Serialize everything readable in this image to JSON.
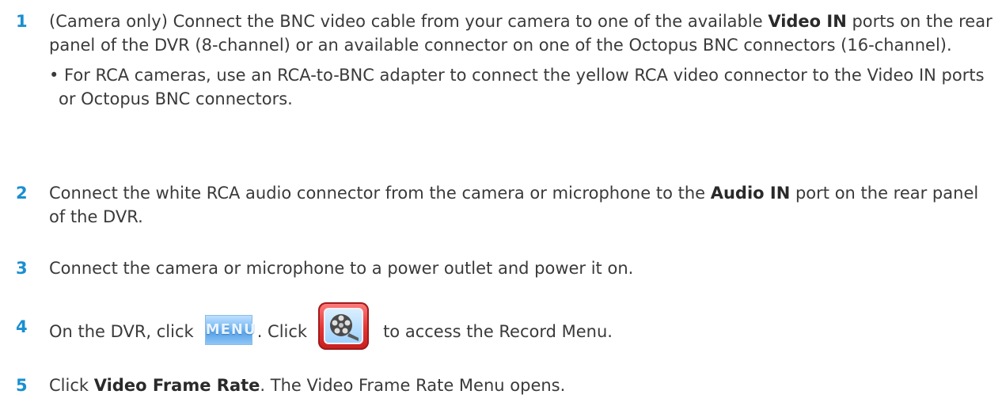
{
  "steps": [
    {
      "num": "1",
      "text_a": "(Camera only) Connect the BNC video cable from your camera to one of the available ",
      "bold_a": "Video IN",
      "text_b": " ports on the rear panel of the DVR (8-channel) or an available connector on one of the Octopus BNC connectors (16-channel).",
      "bullet": "• For RCA cameras, use an RCA-to-BNC adapter to connect the yellow RCA video connector to the Video IN ports or Octopus BNC connectors."
    },
    {
      "num": "2",
      "text_a": "Connect the white RCA audio connector from the camera or microphone to the ",
      "bold_a": "Audio IN",
      "text_b": " port on the rear panel of the DVR."
    },
    {
      "num": "3",
      "text_a": "Connect the camera or microphone to a power outlet and power it on."
    },
    {
      "num": "4",
      "text_a": "On the DVR, click",
      "menu_icon_label": "MENU",
      "text_b": ". Click",
      "text_c": "to access the Record Menu.",
      "record_icon": "film-reel-icon"
    },
    {
      "num": "5",
      "text_a": "Click ",
      "bold_a": "Video Frame Rate",
      "text_b": ". The Video Frame Rate Menu opens."
    }
  ],
  "colors": {
    "step_number": "#1a8fd0",
    "body_text": "#3a3a3a"
  }
}
